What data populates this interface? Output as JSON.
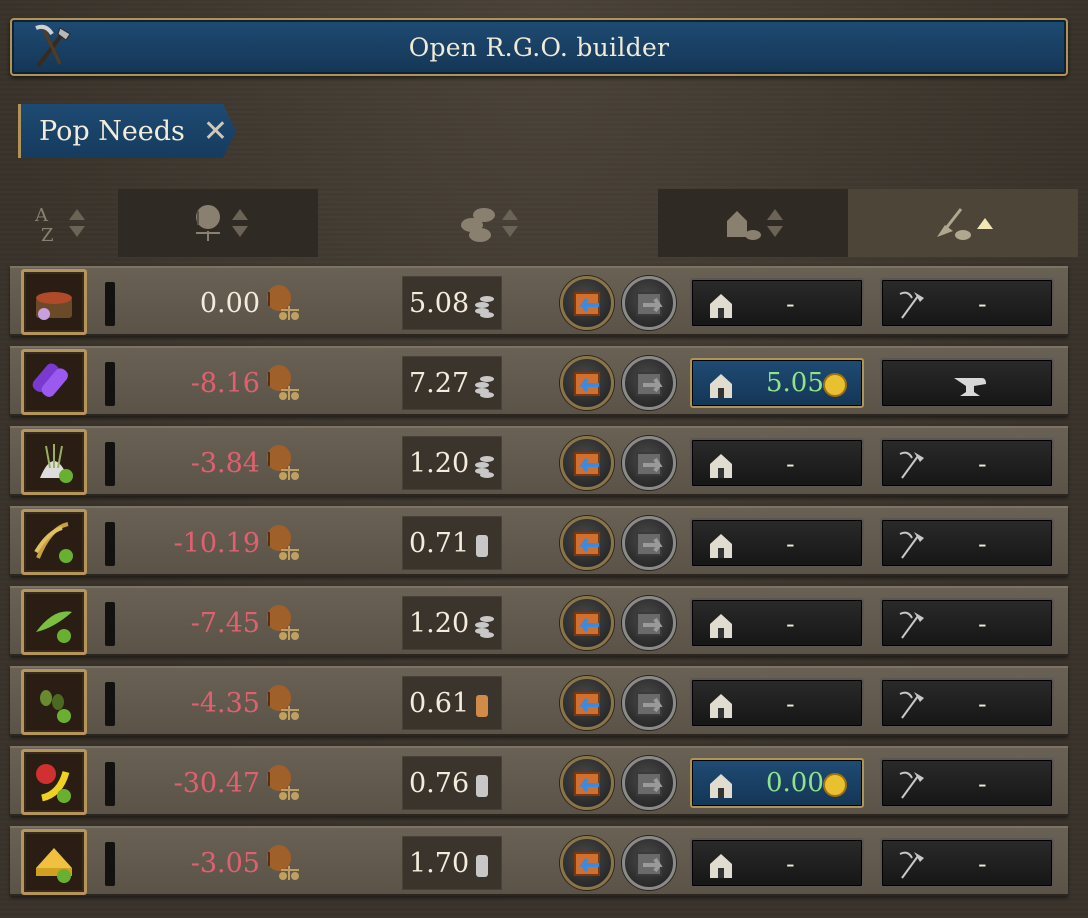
{
  "builder": {
    "label": "Open R.G.O. builder",
    "icon": "shovel-pickaxe-icon"
  },
  "filter_tag": {
    "label": "Pop Needs",
    "close": "✕"
  },
  "sort_header": [
    {
      "name": "sort-alphabetical",
      "icon": "a-z-icon"
    },
    {
      "name": "sort-balance",
      "icon": "barrel-scale-icon"
    },
    {
      "name": "sort-price",
      "icon": "coins-stack-icon"
    },
    {
      "name": "sort-factory",
      "icon": "factory-coins-icon"
    },
    {
      "name": "sort-rgo",
      "icon": "shovel-coins-icon",
      "active": true
    }
  ],
  "colors": {
    "negative": "#e06070",
    "positive": "#8fe38a",
    "accent_blue": "#1f4b73",
    "gold_border": "#b09457"
  },
  "goods": [
    {
      "icon": "spices-icon",
      "balance": "0.00",
      "price": "5.08",
      "price_level": "high",
      "factory": "-",
      "factory_active": false,
      "rgo": "-",
      "rgo_type": "shovel"
    },
    {
      "icon": "silk-cloth-icon",
      "balance": "-8.16",
      "price": "7.27",
      "price_level": "high",
      "factory": "5.05",
      "factory_active": true,
      "rgo": "",
      "rgo_type": "anvil"
    },
    {
      "icon": "rice-grain-icon",
      "balance": "-3.84",
      "price": "1.20",
      "price_level": "high",
      "factory": "-",
      "factory_active": false,
      "rgo": "-",
      "rgo_type": "shovel"
    },
    {
      "icon": "wheat-icon",
      "balance": "-10.19",
      "price": "0.71",
      "price_level": "low",
      "factory": "-",
      "factory_active": false,
      "rgo": "-",
      "rgo_type": "shovel"
    },
    {
      "icon": "legumes-icon",
      "balance": "-7.45",
      "price": "1.20",
      "price_level": "high",
      "factory": "-",
      "factory_active": false,
      "rgo": "-",
      "rgo_type": "shovel"
    },
    {
      "icon": "olives-icon",
      "balance": "-4.35",
      "price": "0.61",
      "price_level": "copper",
      "factory": "-",
      "factory_active": false,
      "rgo": "-",
      "rgo_type": "shovel"
    },
    {
      "icon": "fruit-icon",
      "balance": "-30.47",
      "price": "0.76",
      "price_level": "low",
      "factory": "0.00",
      "factory_active": true,
      "rgo": "-",
      "rgo_type": "shovel"
    },
    {
      "icon": "cheese-icon",
      "balance": "-3.05",
      "price": "1.70",
      "price_level": "low",
      "factory": "-",
      "factory_active": false,
      "rgo": "-",
      "rgo_type": "shovel"
    }
  ]
}
